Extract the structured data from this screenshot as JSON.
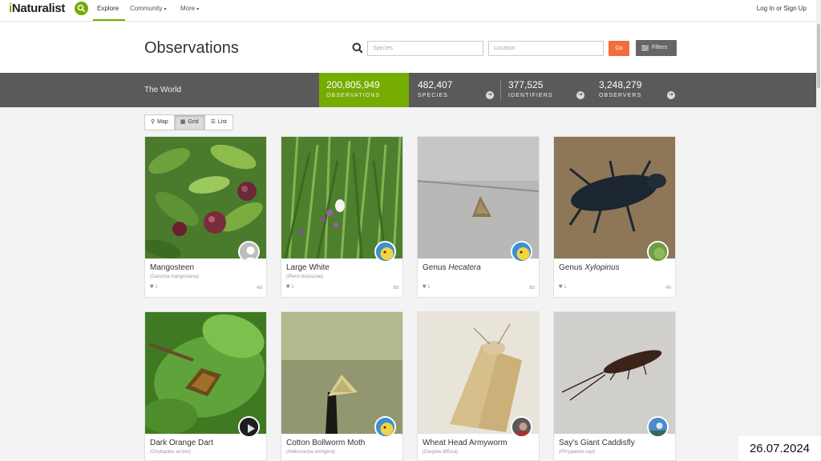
{
  "nav": {
    "logo": "iNaturalist",
    "explore": "Explore",
    "community": "Community",
    "more": "More",
    "login": "Log In or Sign Up"
  },
  "header": {
    "title": "Observations",
    "species_placeholder": "Species",
    "location_placeholder": "Location",
    "go": "Go",
    "filters": "Filters"
  },
  "stats": {
    "place": "The World",
    "observations": {
      "value": "200,805,949",
      "label": "OBSERVATIONS"
    },
    "species": {
      "value": "482,407",
      "label": "SPECIES"
    },
    "identifiers": {
      "value": "377,525",
      "label": "IDENTIFIERS"
    },
    "observers": {
      "value": "3,248,279",
      "label": "OBSERVERS"
    }
  },
  "view_tabs": {
    "map": "Map",
    "grid": "Grid",
    "list": "List",
    "active": "grid"
  },
  "cards": [
    {
      "title": "Mangosteen",
      "sci": "(Garcinia mangostana)",
      "ids": "1",
      "time": "4d"
    },
    {
      "title": "Large White",
      "sci": "(Pieris brassicae)",
      "ids": "1",
      "time": "8d"
    },
    {
      "title_prefix": "Genus ",
      "title_italic": "Hecatera",
      "sci": "",
      "ids": "1",
      "time": "8d"
    },
    {
      "title_prefix": "Genus ",
      "title_italic": "Xylopinus",
      "sci": "",
      "ids": "1",
      "time": "4h"
    },
    {
      "title": "Dark Orange Dart",
      "sci": "(Oxybaptes arcion)"
    },
    {
      "title": "Cotton Bollworm Moth",
      "sci": "(Helicoverpa armigera)"
    },
    {
      "title": "Wheat Head Armyworm",
      "sci": "(Dargida diffusa)"
    },
    {
      "title": "Say's Giant Caddisfly",
      "sci": "(Phryganea sayi)"
    }
  ],
  "datestamp": "26.07.2024",
  "colors": {
    "accent": "#74ac00",
    "stats_bar": "#5a5a5a",
    "go": "#f26d3d"
  }
}
